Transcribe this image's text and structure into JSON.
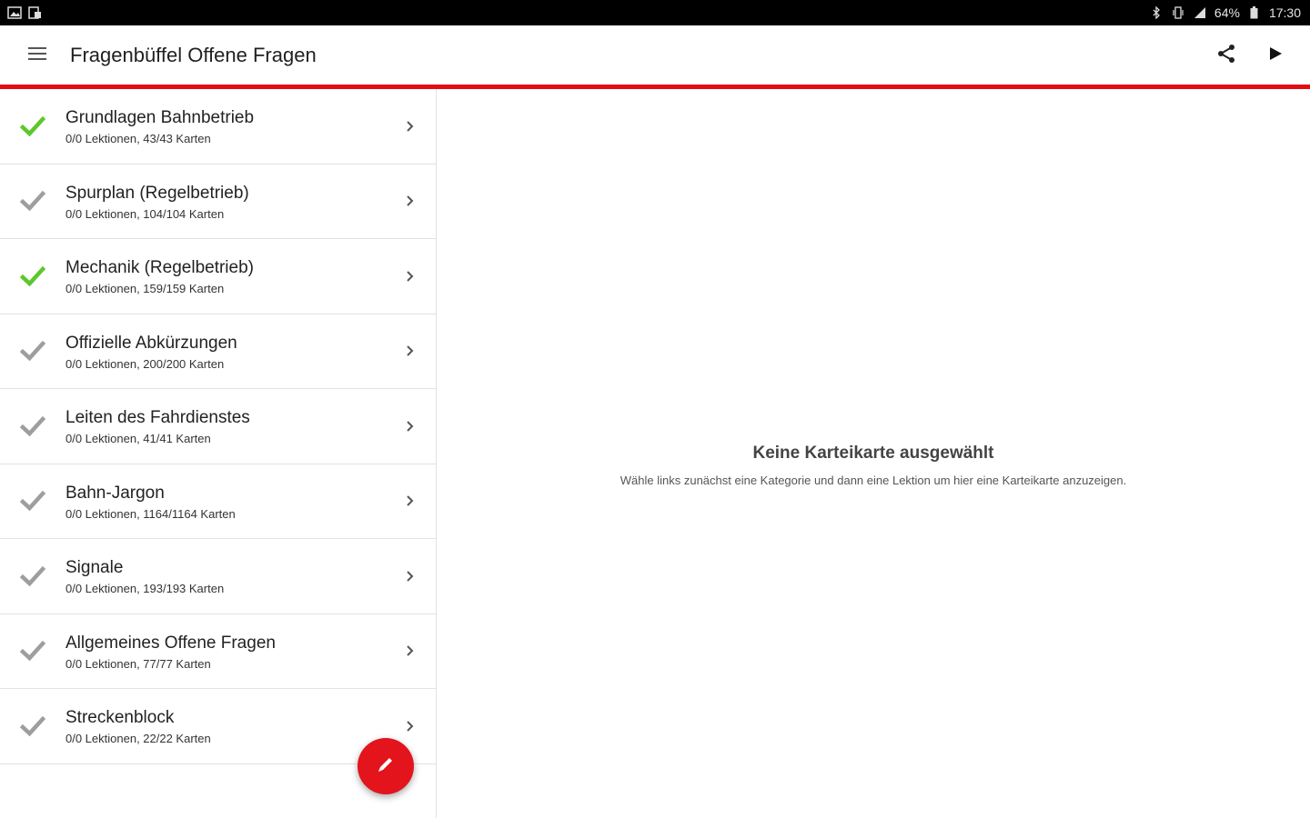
{
  "status_bar": {
    "battery": "64%",
    "time": "17:30"
  },
  "app_bar": {
    "title": "Fragenbüffel Offene Fragen",
    "accent_color": "#e10d13"
  },
  "categories": [
    {
      "title": "Grundlagen Bahnbetrieb",
      "subtitle": "0/0 Lektionen, 43/43 Karten",
      "check_color": "#5ec72b"
    },
    {
      "title": "Spurplan (Regelbetrieb)",
      "subtitle": "0/0 Lektionen, 104/104 Karten",
      "check_color": "#9e9e9e"
    },
    {
      "title": "Mechanik (Regelbetrieb)",
      "subtitle": "0/0 Lektionen, 159/159 Karten",
      "check_color": "#5ec72b"
    },
    {
      "title": "Offizielle Abkürzungen",
      "subtitle": "0/0 Lektionen, 200/200 Karten",
      "check_color": "#9e9e9e"
    },
    {
      "title": "Leiten des Fahrdienstes",
      "subtitle": "0/0 Lektionen, 41/41 Karten",
      "check_color": "#9e9e9e"
    },
    {
      "title": "Bahn-Jargon",
      "subtitle": "0/0 Lektionen, 1164/1164 Karten",
      "check_color": "#9e9e9e"
    },
    {
      "title": "Signale",
      "subtitle": "0/0 Lektionen, 193/193 Karten",
      "check_color": "#9e9e9e"
    },
    {
      "title": "Allgemeines Offene Fragen",
      "subtitle": "0/0 Lektionen, 77/77 Karten",
      "check_color": "#9e9e9e"
    },
    {
      "title": "Streckenblock",
      "subtitle": "0/0 Lektionen, 22/22 Karten",
      "check_color": "#9e9e9e"
    }
  ],
  "detail": {
    "empty_title": "Keine Karteikarte ausgewählt",
    "empty_message": "Wähle links zunächst eine Kategorie und dann eine Lektion um hier eine Karteikarte anzuzeigen."
  },
  "fab": {
    "icon": "pencil-icon",
    "color": "#e3141b"
  }
}
